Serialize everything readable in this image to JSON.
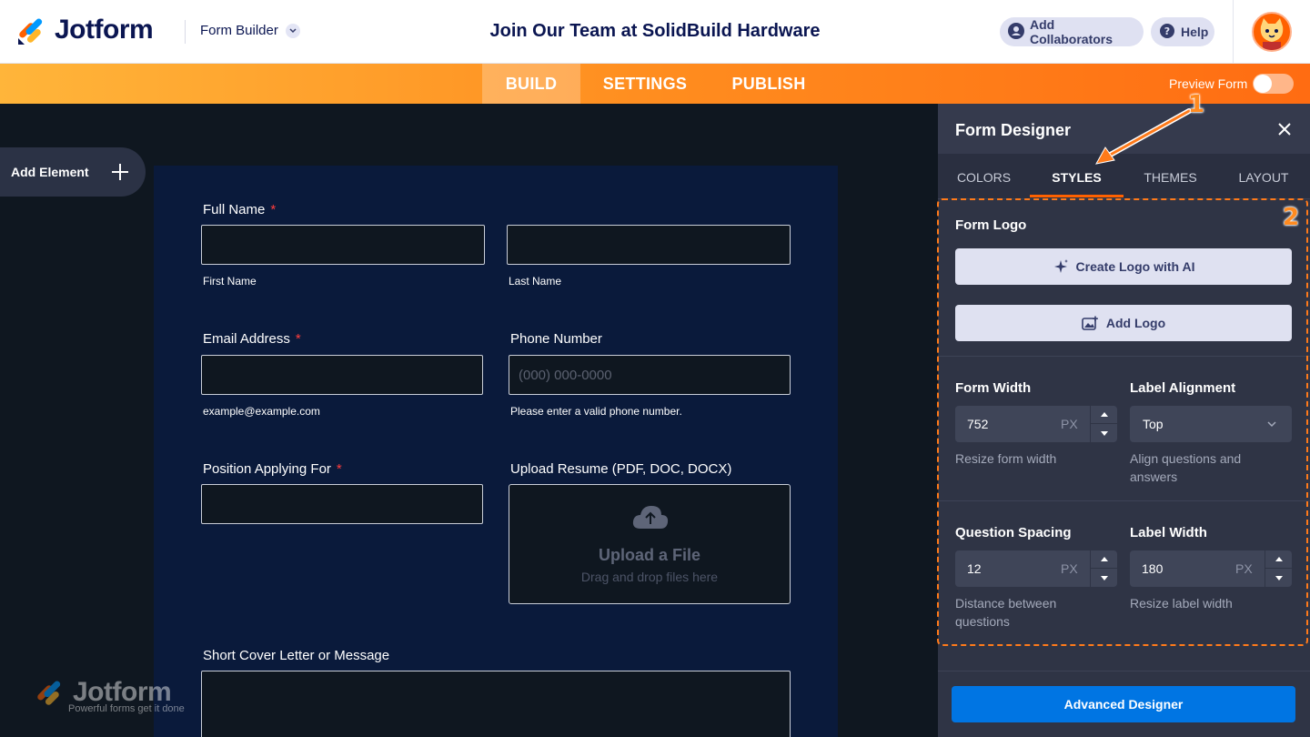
{
  "header": {
    "logo_text": "Jotform",
    "builder_label": "Form Builder",
    "form_title": "Join Our Team at SolidBuild Hardware",
    "collaborators_label": "Add Collaborators",
    "help_label": "Help"
  },
  "nav": {
    "tabs": [
      {
        "label": "BUILD",
        "active": true
      },
      {
        "label": "SETTINGS",
        "active": false
      },
      {
        "label": "PUBLISH",
        "active": false
      }
    ],
    "preview_label": "Preview Form",
    "preview_enabled": false
  },
  "canvas": {
    "add_element_label": "Add Element",
    "fields": {
      "full_name": {
        "label": "Full Name",
        "required": "*",
        "first_sub": "First Name",
        "last_sub": "Last Name"
      },
      "email": {
        "label": "Email Address",
        "required": "*",
        "sub": "example@example.com"
      },
      "phone": {
        "label": "Phone Number",
        "placeholder": "(000) 000-0000",
        "sub": "Please enter a valid phone number."
      },
      "position": {
        "label": "Position Applying For",
        "required": "*"
      },
      "resume": {
        "label": "Upload Resume (PDF, DOC, DOCX)",
        "upload_title": "Upload a File",
        "upload_sub": "Drag and drop files here"
      },
      "cover": {
        "label": "Short Cover Letter or Message"
      }
    },
    "watermark": {
      "word": "Jotform",
      "tagline": "Powerful forms get it done"
    }
  },
  "designer": {
    "title": "Form Designer",
    "tabs": [
      {
        "label": "COLORS",
        "active": false
      },
      {
        "label": "STYLES",
        "active": true
      },
      {
        "label": "THEMES",
        "active": false
      },
      {
        "label": "LAYOUT",
        "active": false
      }
    ],
    "form_logo": {
      "title": "Form Logo",
      "create_ai_label": "Create Logo with AI",
      "add_logo_label": "Add Logo"
    },
    "form_width": {
      "title": "Form Width",
      "value": "752",
      "unit": "PX",
      "hint": "Resize form width"
    },
    "label_alignment": {
      "title": "Label Alignment",
      "value": "Top",
      "hint": "Align questions and answers"
    },
    "question_spacing": {
      "title": "Question Spacing",
      "value": "12",
      "unit": "PX",
      "hint": "Distance between questions"
    },
    "label_width": {
      "title": "Label Width",
      "value": "180",
      "unit": "PX",
      "hint": "Resize label width"
    },
    "advanced_label": "Advanced Designer"
  },
  "annotations": {
    "marker_1": "1",
    "marker_2": "2"
  },
  "colors": {
    "brand_orange": "#ff6100",
    "primary_blue": "#0075e3",
    "navy": "#0a1551",
    "annotation": "#ff7a1a"
  }
}
